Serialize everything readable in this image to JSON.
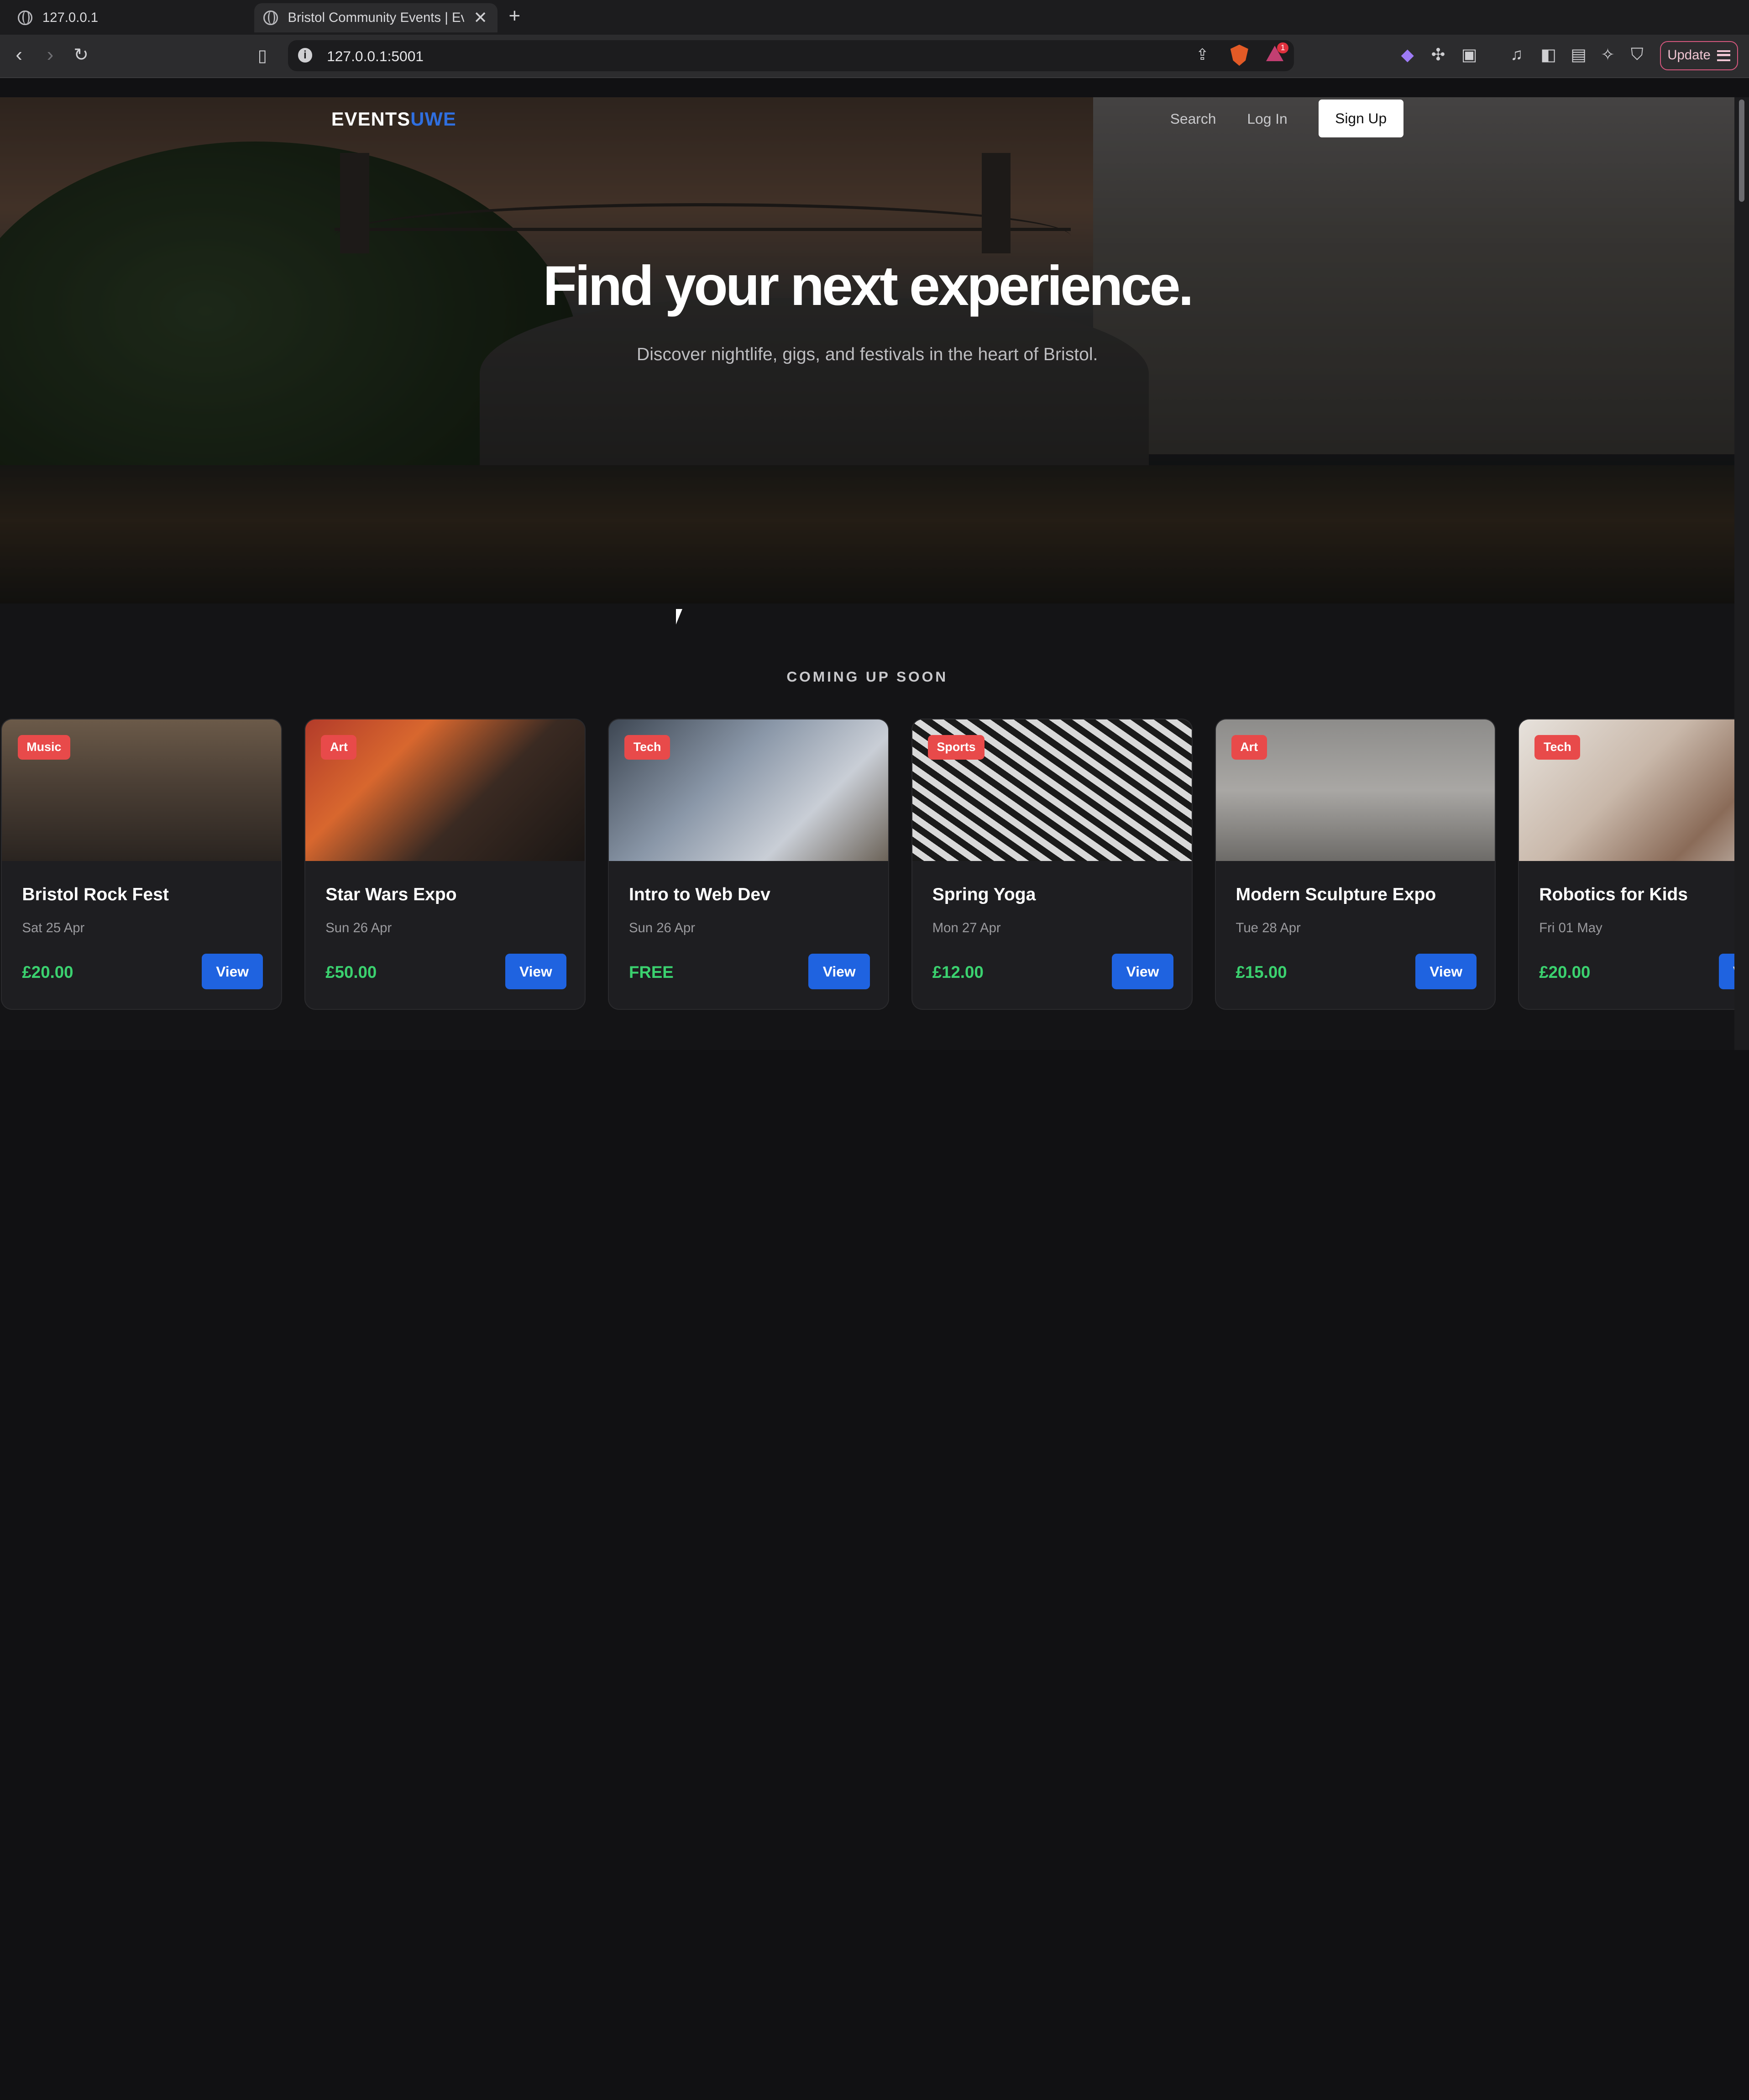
{
  "browser": {
    "tabs": [
      {
        "title": "127.0.0.1"
      },
      {
        "title": "Bristol Community Events | Ev"
      }
    ],
    "new_tab": "+",
    "address": "127.0.0.1:5001",
    "update_label": "Update",
    "rewards_count": "1"
  },
  "nav": {
    "logo_main": "EVENTS",
    "logo_accent": "UWE",
    "search": "Search",
    "login": "Log In",
    "signup": "Sign Up"
  },
  "hero": {
    "title": "Find your next experience.",
    "subtitle": "Discover nightlife, gigs, and festivals in the heart of Bristol."
  },
  "section": {
    "title": "COMING UP SOON"
  },
  "events": [
    {
      "tag": "Music",
      "name": "Bristol Rock Fest",
      "date": "Sat 25 Apr",
      "price": "£20.00",
      "action": "View"
    },
    {
      "tag": "Art",
      "name": "Star Wars Expo",
      "date": "Sun 26 Apr",
      "price": "£50.00",
      "action": "View"
    },
    {
      "tag": "Tech",
      "name": "Intro to Web Dev",
      "date": "Sun 26 Apr",
      "price": "FREE",
      "action": "View"
    },
    {
      "tag": "Sports",
      "name": "Spring Yoga",
      "date": "Mon 27 Apr",
      "price": "£12.00",
      "action": "View"
    },
    {
      "tag": "Art",
      "name": "Modern Sculpture Expo",
      "date": "Tue 28 Apr",
      "price": "£15.00",
      "action": "View"
    },
    {
      "tag": "Tech",
      "name": "Robotics for Kids",
      "date": "Fri 01 May",
      "price": "£20.00",
      "action": "View"
    }
  ],
  "colors": {
    "accent": "#1f63e0",
    "tag": "#e84a4a",
    "price": "#3bd16f",
    "background": "#141416"
  }
}
